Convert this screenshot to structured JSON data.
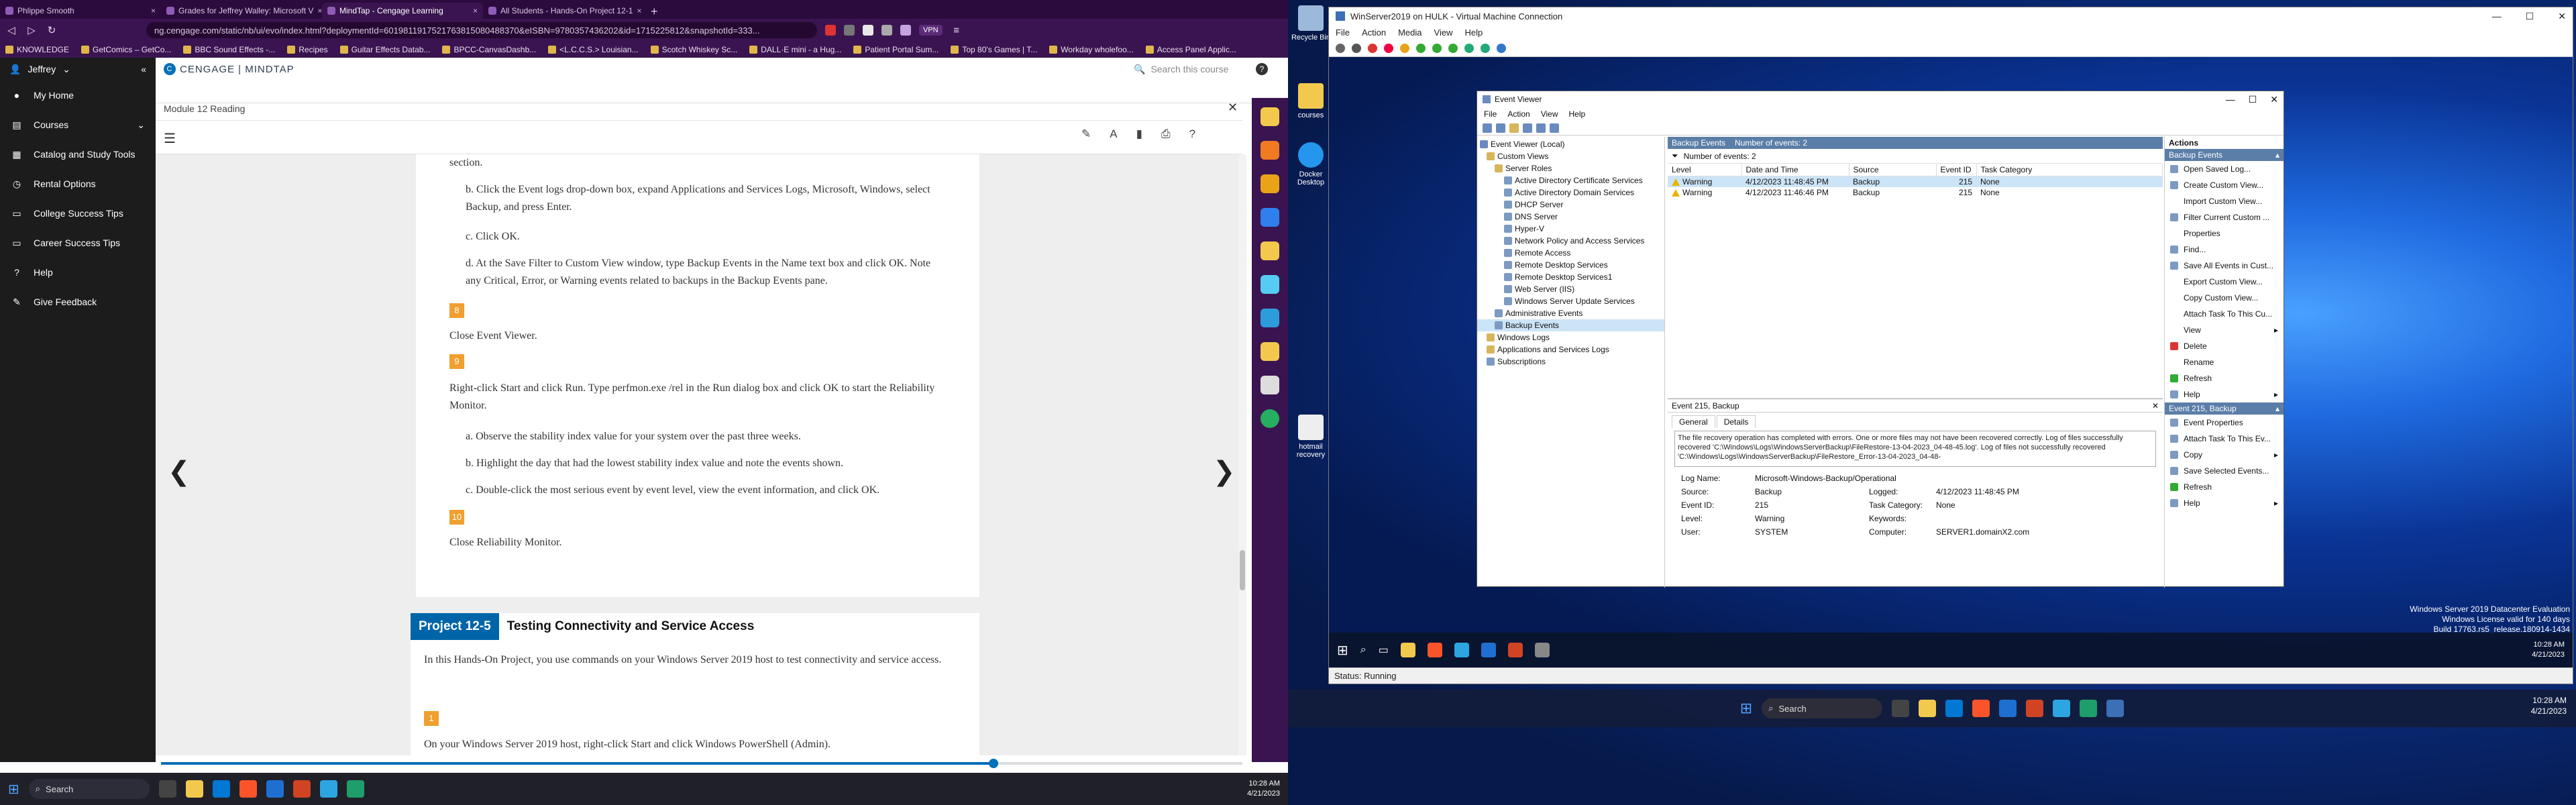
{
  "browser": {
    "tabs": [
      {
        "label": "Phlippe Smooth"
      },
      {
        "label": "Grades for Jeffrey Walley: Microsoft V"
      },
      {
        "label": "MindTap - Cengage Learning"
      },
      {
        "label": "All Students - Hands-On Project 12-1"
      }
    ],
    "url": "ng.cengage.com/static/nb/ui/evo/index.html?deploymentId=6019811917521763815080488370&eISBN=9780357436202&id=1715225812&snapshotId=333...",
    "vpn_label": "VPN",
    "bookmarks": [
      "KNOWLEDGE",
      "GetComics – GetCo...",
      "BBC Sound Effects -...",
      "Recipes",
      "Guitar Effects Datab...",
      "BPCC-CanvasDashb...",
      "<L.C.C.S.> Louisian...",
      "Scotch Whiskey Sc...",
      "DALL·E mini - a Hug...",
      "Patient Portal Sum...",
      "Top 80's Games | T...",
      "Workday wholefoo...",
      "Access Panel Applic..."
    ]
  },
  "cengage": {
    "user": "Jeffrey",
    "brand": "CENGAGE | MINDTAP",
    "search_placeholder": "Search this course",
    "sidebar": [
      {
        "icon": "user-icon",
        "label": "My Home"
      },
      {
        "icon": "courses-icon",
        "label": "Courses"
      },
      {
        "icon": "catalog-icon",
        "label": "Catalog and Study Tools"
      },
      {
        "icon": "rental-icon",
        "label": "Rental Options"
      },
      {
        "icon": "success-icon",
        "label": "College Success Tips"
      },
      {
        "icon": "career-icon",
        "label": "Career Success Tips"
      },
      {
        "icon": "help-icon",
        "label": "Help"
      },
      {
        "icon": "feedback-icon",
        "label": "Give Feedback"
      }
    ],
    "module_title": "Module 12 Reading",
    "content": {
      "section_tail": "section.",
      "step_b": "b. Click the Event logs drop-down box, expand Applications and Services Logs, Microsoft, Windows, select Backup, and press Enter.",
      "step_c": "c. Click OK.",
      "step_d": "d. At the Save Filter to Custom View window, type Backup Events in the Name text box and click OK. Note any Critical, Error, or Warning events related to backups in the Backup Events pane.",
      "num_8": "8",
      "step_8": "Close Event Viewer.",
      "num_9": "9",
      "step_9": "Right-click Start and click Run. Type perfmon.exe /rel in the Run dialog box and click OK to start the Reliability Monitor.",
      "step_9a": "a. Observe the stability index value for your system over the past three weeks.",
      "step_9b": "b. Highlight the day that had the lowest stability index value and note the events shown.",
      "step_9c": "c. Double-click the most serious event by event level, view the event information, and click OK.",
      "num_10": "10",
      "step_10": "Close Reliability Monitor.",
      "project_badge": "Project 12-5",
      "project_title": "Testing Connectivity and Service Access",
      "project_intro": "In this Hands-On Project, you use commands on your Windows Server 2019 host to test connectivity and service access.",
      "num_1": "1",
      "step_1": "On your Windows Server 2019 host, right-click Start and click Windows PowerShell (Admin)."
    },
    "progress_fraction": 0.77
  },
  "taskbar_left": {
    "search_label": "Search",
    "time": "10:28 AM",
    "date": "4/21/2023"
  },
  "desktop": {
    "icons": [
      "Recycle Bin",
      "courses",
      "Docker Desktop",
      "hotmail recovery"
    ]
  },
  "vm": {
    "title": "WinServer2019 on HULK - Virtual Machine Connection",
    "menu": [
      "File",
      "Action",
      "Media",
      "View",
      "Help"
    ],
    "status": "Status: Running",
    "watermark": [
      "Windows Server 2019 Datacenter Evaluation",
      "Windows License valid for 140 days",
      "Build 17763.rs5_release.180914-1434"
    ],
    "time": "10:28 AM",
    "date": "4/21/2023"
  },
  "event_viewer": {
    "title": "Event Viewer",
    "menu": [
      "File",
      "Action",
      "View",
      "Help"
    ],
    "tree": [
      "Event Viewer (Local)",
      "Custom Views",
      "Server Roles",
      "Active Directory Certificate Services",
      "Active Directory Domain Services",
      "DHCP Server",
      "DNS Server",
      "Hyper-V",
      "Network Policy and Access Services",
      "Remote Access",
      "Remote Desktop Services",
      "Remote Desktop Services1",
      "Web Server (IIS)",
      "Windows Server Update Services",
      "Administrative Events",
      "Backup Events",
      "Windows Logs",
      "Applications and Services Logs",
      "Subscriptions"
    ],
    "pane_title": "Backup Events",
    "pane_count": "Number of events: 2",
    "filter_text": "Number of events: 2",
    "columns": [
      "Level",
      "Date and Time",
      "Source",
      "Event ID",
      "Task Category"
    ],
    "rows": [
      [
        "Warning",
        "4/12/2023 11:48:45 PM",
        "Backup",
        "215",
        "None"
      ],
      [
        "Warning",
        "4/12/2023 11:46:46 PM",
        "Backup",
        "215",
        "None"
      ]
    ],
    "detail_title": "Event 215, Backup",
    "detail_tabs": [
      "General",
      "Details"
    ],
    "description": "The file recovery operation has completed with errors. One or more files may not have been recovered correctly. Log of files successfully recovered 'C:\\Windows\\Logs\\WindowsServerBackup\\FileRestore-13-04-2023_04-48-45.log'. Log of files not successfully recovered 'C:\\Windows\\Logs\\WindowsServerBackup\\FileRestore_Error-13-04-2023_04-48-",
    "fields": {
      "log_name_label": "Log Name:",
      "log_name": "Microsoft-Windows-Backup/Operational",
      "source_label": "Source:",
      "source": "Backup",
      "logged_label": "Logged:",
      "logged": "4/12/2023 11:48:45 PM",
      "event_id_label": "Event ID:",
      "event_id": "215",
      "task_label": "Task Category:",
      "task": "None",
      "level_label": "Level:",
      "level": "Warning",
      "keywords_label": "Keywords:",
      "keywords": "",
      "user_label": "User:",
      "user": "SYSTEM",
      "computer_label": "Computer:",
      "computer": "SERVER1.domainX2.com"
    },
    "actions_header1": "Backup Events",
    "actions1": [
      "Open Saved Log...",
      "Create Custom View...",
      "Import Custom View...",
      "Filter Current Custom ...",
      "Properties",
      "Find...",
      "Save All Events in Cust...",
      "Export Custom View...",
      "Copy Custom View...",
      "Attach Task To This Cu...",
      "View",
      "Delete",
      "Rename",
      "Refresh",
      "Help"
    ],
    "actions_header2": "Event 215, Backup",
    "actions2": [
      "Event Properties",
      "Attach Task To This Ev...",
      "Copy",
      "Save Selected Events...",
      "Refresh",
      "Help"
    ]
  },
  "host_taskbar": {
    "search_label": "Search",
    "time": "10:28 AM",
    "date": "4/21/2023"
  }
}
